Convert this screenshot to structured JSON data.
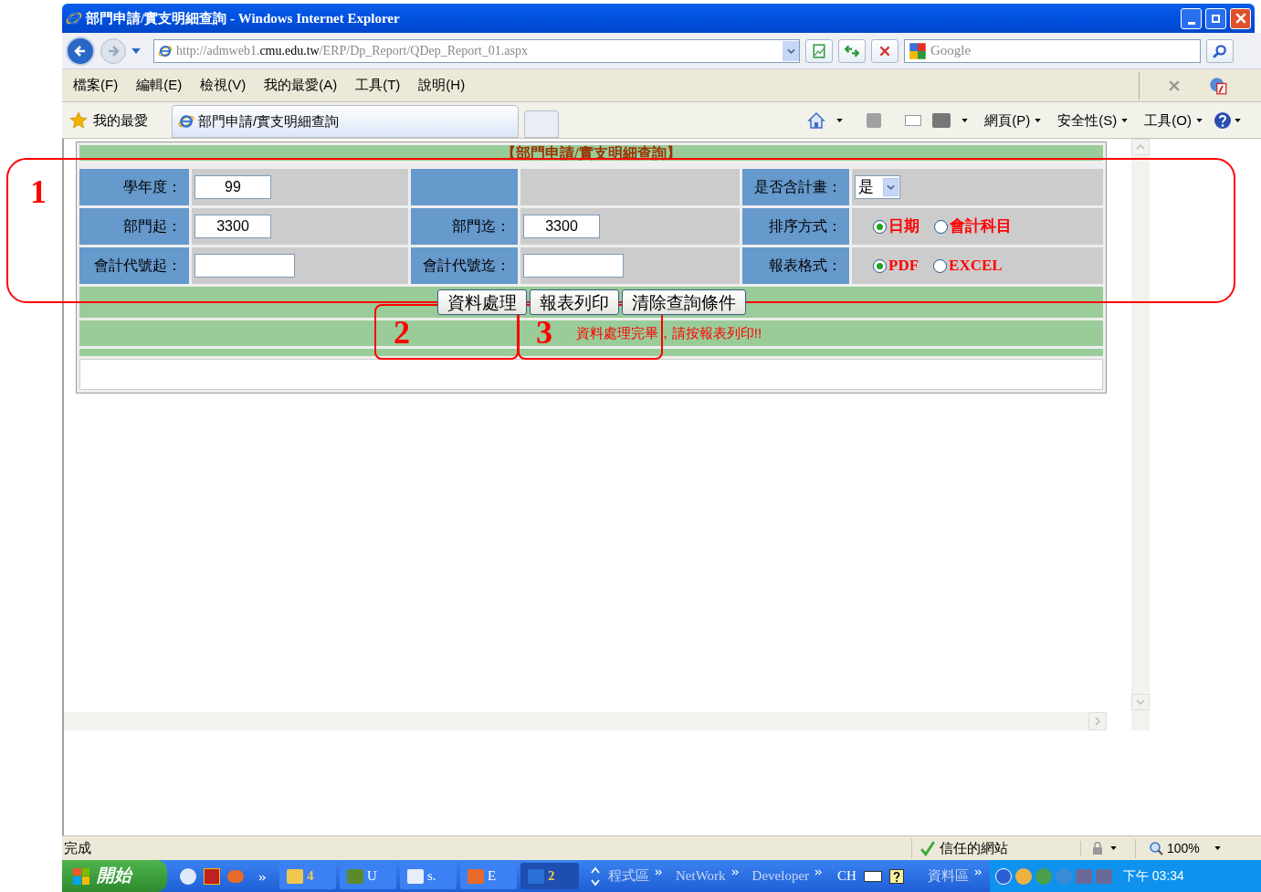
{
  "window": {
    "title": "部門申請/實支明細查詢 - Windows Internet Explorer"
  },
  "address_bar": {
    "url_parts": [
      {
        "text": "http://admweb1.",
        "kind": "dim"
      },
      {
        "text": "cmu.edu.tw",
        "kind": "host"
      },
      {
        "text": "/ERP/Dp_Report/QDep_Report_01.aspx",
        "kind": "dim"
      }
    ],
    "search_placeholder": "Google"
  },
  "menu": [
    "檔案(F)",
    "編輯(E)",
    "檢視(V)",
    "我的最愛(A)",
    "工具(T)",
    "說明(H)"
  ],
  "favorites": {
    "label": "我的最愛",
    "tabs": [
      {
        "title": "部門申請/實支明細查詢",
        "selected": true
      }
    ]
  },
  "command_bar": [
    "網頁(P)",
    "安全性(S)",
    "工具(O)"
  ],
  "form": {
    "title": "【部門申請/實支明細查詢】",
    "rows": [
      {
        "cells": [
          {
            "kind": "text",
            "label": "學年度：",
            "value": "99"
          },
          {
            "kind": "blank"
          },
          {
            "kind": "select",
            "label": "是否含計畫：",
            "value": "是"
          }
        ]
      },
      {
        "cells": [
          {
            "kind": "text",
            "label": "部門起：",
            "value": "3300"
          },
          {
            "kind": "text",
            "label": "部門迄：",
            "value": "3300"
          },
          {
            "kind": "radio",
            "label": "排序方式：",
            "options": [
              {
                "label": "日期",
                "selected": true
              },
              {
                "label": "會計科目",
                "selected": false
              }
            ]
          }
        ]
      },
      {
        "cells": [
          {
            "kind": "text",
            "label": "會計代號起："
          },
          {
            "kind": "text",
            "label": "會計代號迄："
          },
          {
            "kind": "radio",
            "label": "報表格式：",
            "options": [
              {
                "label": "PDF",
                "selected": true
              },
              {
                "label": "EXCEL",
                "selected": false
              }
            ]
          }
        ]
      }
    ],
    "buttons": [
      "資料處理",
      "報表列印",
      "清除查詢條件"
    ],
    "message": "資料處理完畢，請按報表列印!!"
  },
  "status_bar": {
    "status": "完成",
    "zone": "信任的網站",
    "zoom": "100%"
  },
  "taskbar": {
    "start": "開始",
    "buttons": [
      {
        "label": "4",
        "kind": "folder",
        "selected": false
      },
      {
        "label": "U",
        "kind": "frog",
        "selected": false
      },
      {
        "label": "s.",
        "kind": "word",
        "selected": false
      },
      {
        "label": "E",
        "kind": "app",
        "selected": false
      },
      {
        "label": "2",
        "kind": "ie",
        "selected": true
      }
    ],
    "toolbars": [
      "程式區",
      "NetWork",
      "Developer"
    ],
    "language": "CH",
    "toolbar_tail": "資料區",
    "clock": "下午 03:34"
  },
  "annotations": [
    {
      "label": "1"
    },
    {
      "label": "2"
    },
    {
      "label": "3"
    }
  ]
}
